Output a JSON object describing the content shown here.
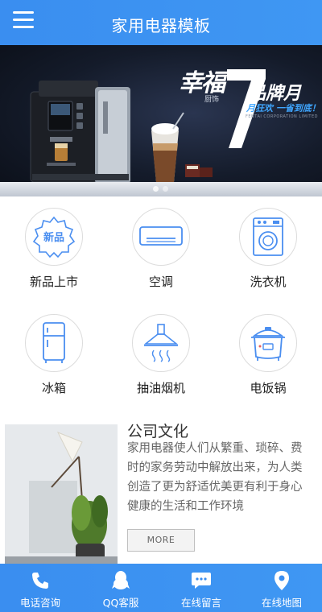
{
  "header": {
    "title": "家用电器模板",
    "menu_icon": "hamburger-menu-icon"
  },
  "banner": {
    "slogan_main": "幸福",
    "slogan_sub": "厨饰",
    "slogan_text": "品牌月",
    "slogan_blue": "月狂欢 一省到底！",
    "slogan_corp": "FENTAI CORPORATION LIMITED",
    "machine_brand": "SIEMENS"
  },
  "categories": [
    {
      "label": "新品上市",
      "icon": "new-badge-icon",
      "badge_text": "新品"
    },
    {
      "label": "空调",
      "icon": "air-conditioner-icon"
    },
    {
      "label": "洗衣机",
      "icon": "washing-machine-icon"
    },
    {
      "label": "冰箱",
      "icon": "refrigerator-icon"
    },
    {
      "label": "抽油烟机",
      "icon": "range-hood-icon"
    },
    {
      "label": "电饭锅",
      "icon": "rice-cooker-icon"
    }
  ],
  "culture": {
    "title": "公司文化",
    "text": "家用电器使人们从繁重、琐碎、费时的家务劳动中解放出来，为人类创造了更为舒适优美更有利于身心健康的生活和工作环境",
    "more_label": "MORE"
  },
  "bottom_nav": [
    {
      "label": "电话咨询",
      "icon": "phone-icon"
    },
    {
      "label": "QQ客服",
      "icon": "qq-penguin-icon"
    },
    {
      "label": "在线留言",
      "icon": "message-bubble-icon"
    },
    {
      "label": "在线地图",
      "icon": "map-pin-icon"
    }
  ],
  "colors": {
    "accent": "#3a8ef0",
    "icon_blue": "#4a8ef0",
    "icon_red": "#e85d5d"
  }
}
